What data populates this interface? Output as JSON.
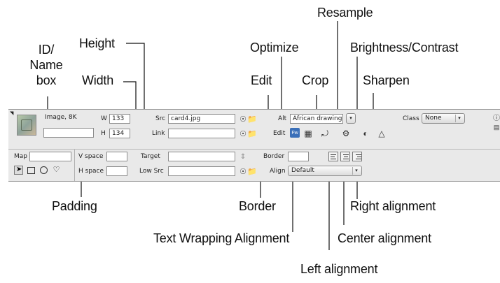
{
  "callouts": {
    "id_name": [
      "ID/",
      "Name",
      "box"
    ],
    "height": "Height",
    "width": "Width",
    "optimize": "Optimize",
    "resample": "Resample",
    "brightness": "Brightness/Contrast",
    "edit": "Edit",
    "crop": "Crop",
    "sharpen": "Sharpen",
    "padding": "Padding",
    "border": "Border",
    "right_alignment": "Right alignment",
    "text_wrapping": "Text Wrapping Alignment",
    "center_alignment": "Center alignment",
    "left_alignment": "Left alignment"
  },
  "inspector": {
    "image_label": "Image, 8K",
    "w_label": "W",
    "w_value": "133",
    "h_label": "H",
    "h_value": "134",
    "src_label": "Src",
    "src_value": "card4.jpg",
    "link_label": "Link",
    "alt_label": "Alt",
    "alt_value": "African drawing",
    "edit_label": "Edit",
    "class_label": "Class",
    "class_value": "None",
    "map_label": "Map",
    "vspace_label": "V space",
    "hspace_label": "H space",
    "target_label": "Target",
    "lowsrc_label": "Low Src",
    "border_label": "Border",
    "align_label": "Align",
    "align_value": "Default",
    "fw_badge": "Fw"
  }
}
